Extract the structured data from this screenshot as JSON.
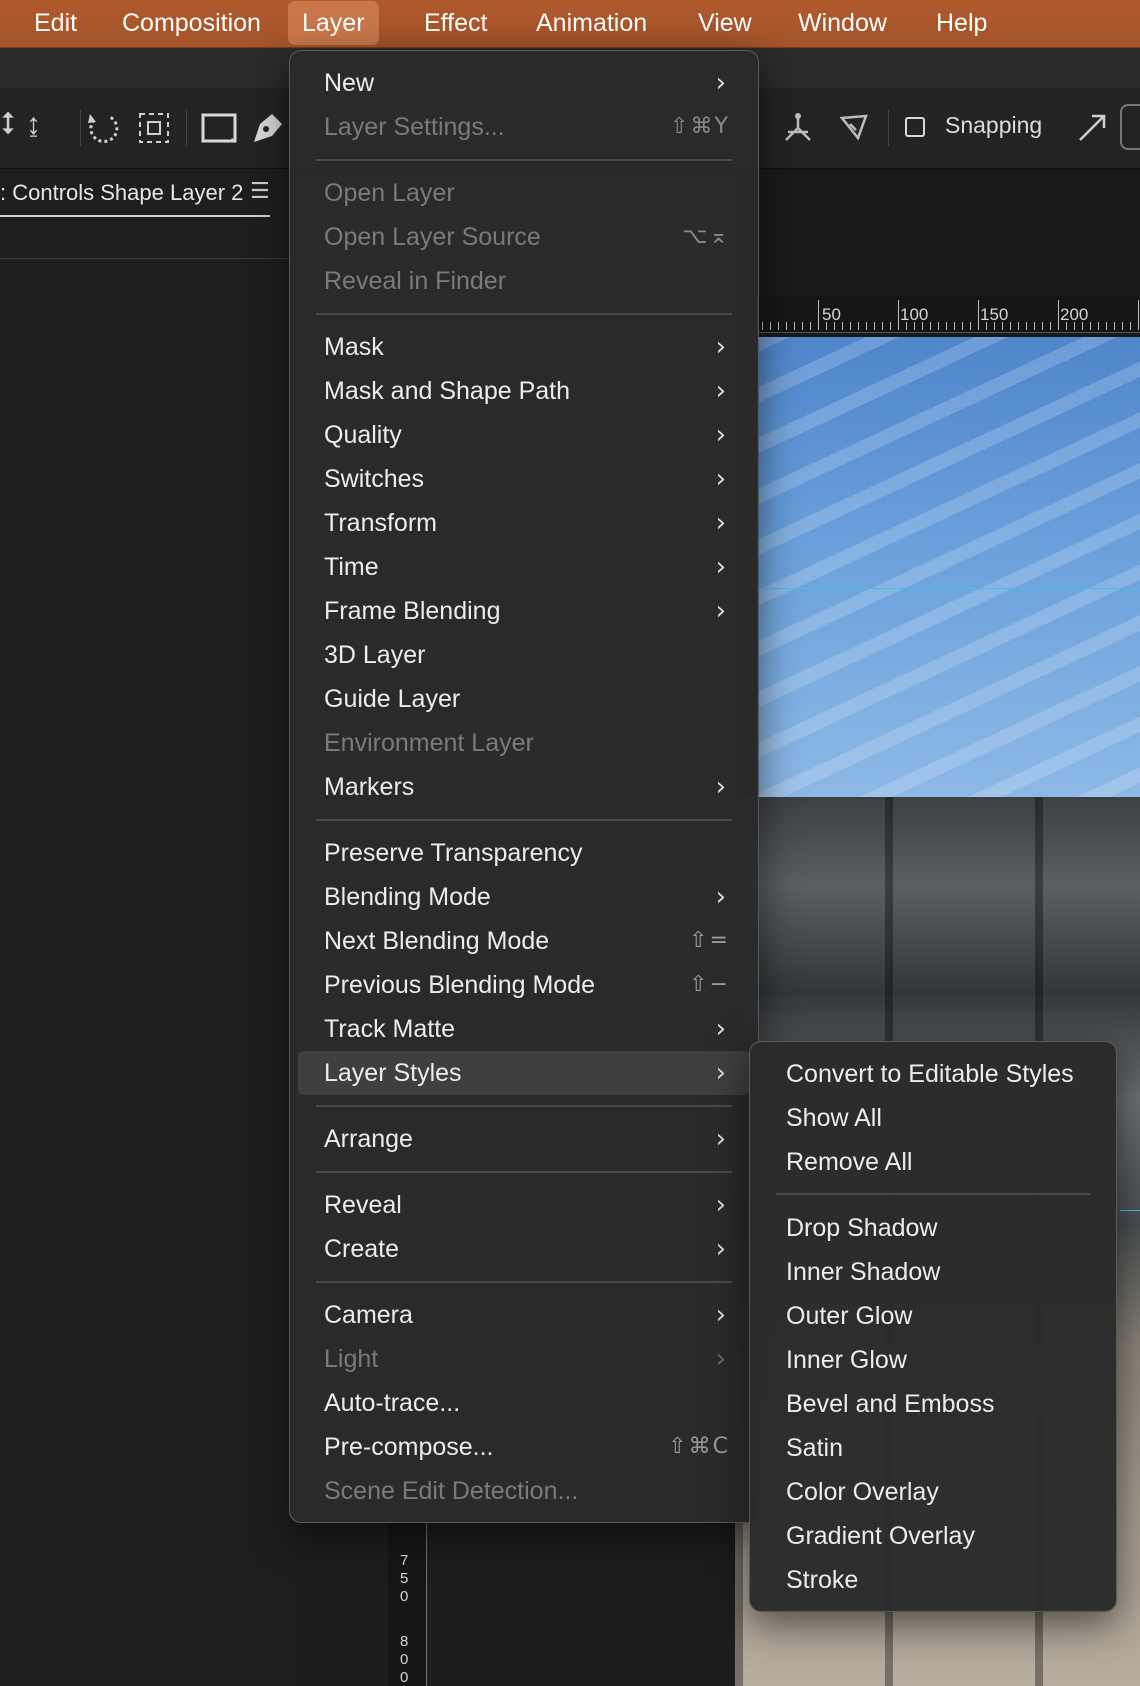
{
  "menubar": {
    "items": [
      "Edit",
      "Composition",
      "Layer",
      "Effect",
      "Animation",
      "View",
      "Window",
      "Help"
    ],
    "active": "Layer"
  },
  "toolbar": {
    "snapping_label": "Snapping",
    "icons": [
      "move-vertical-icon",
      "rotate-icon",
      "selection-frame-icon",
      "rectangle-icon",
      "pen-icon",
      "puppet-icon",
      "puppet-pin-icon",
      "expand-icon"
    ]
  },
  "panel": {
    "tab_label": ": Controls Shape Layer 2",
    "menu_glyph": "☰"
  },
  "ruler": {
    "top_labels": [
      "50",
      "100",
      "150",
      "200"
    ],
    "left_labels": [
      "7",
      "5",
      "0",
      "8",
      "0",
      "0"
    ]
  },
  "layer_menu": {
    "items": [
      {
        "label": "New",
        "enabled": true,
        "submenu": true
      },
      {
        "label": "Layer Settings...",
        "enabled": false,
        "shortcut": "⇧⌘Y"
      },
      {
        "label": "Open Layer",
        "enabled": false
      },
      {
        "label": "Open Layer Source",
        "enabled": false,
        "shortcut": "⌥⌅"
      },
      {
        "label": "Reveal in Finder",
        "enabled": false
      },
      {
        "label": "Mask",
        "enabled": true,
        "submenu": true
      },
      {
        "label": "Mask and Shape Path",
        "enabled": true,
        "submenu": true
      },
      {
        "label": "Quality",
        "enabled": true,
        "submenu": true
      },
      {
        "label": "Switches",
        "enabled": true,
        "submenu": true
      },
      {
        "label": "Transform",
        "enabled": true,
        "submenu": true
      },
      {
        "label": "Time",
        "enabled": true,
        "submenu": true
      },
      {
        "label": "Frame Blending",
        "enabled": true,
        "submenu": true
      },
      {
        "label": "3D Layer",
        "enabled": true
      },
      {
        "label": "Guide Layer",
        "enabled": true
      },
      {
        "label": "Environment Layer",
        "enabled": false
      },
      {
        "label": "Markers",
        "enabled": true,
        "submenu": true
      },
      {
        "label": "Preserve Transparency",
        "enabled": true
      },
      {
        "label": "Blending Mode",
        "enabled": true,
        "submenu": true
      },
      {
        "label": "Next Blending Mode",
        "enabled": true,
        "shortcut": "⇧="
      },
      {
        "label": "Previous Blending Mode",
        "enabled": true,
        "shortcut": "⇧−"
      },
      {
        "label": "Track Matte",
        "enabled": true,
        "submenu": true
      },
      {
        "label": "Layer Styles",
        "enabled": true,
        "submenu": true,
        "highlighted": true
      },
      {
        "label": "Arrange",
        "enabled": true,
        "submenu": true
      },
      {
        "label": "Reveal",
        "enabled": true,
        "submenu": true
      },
      {
        "label": "Create",
        "enabled": true,
        "submenu": true
      },
      {
        "label": "Camera",
        "enabled": true,
        "submenu": true
      },
      {
        "label": "Light",
        "enabled": false,
        "submenu": true
      },
      {
        "label": "Auto-trace...",
        "enabled": true
      },
      {
        "label": "Pre-compose...",
        "enabled": true,
        "shortcut": "⇧⌘C"
      },
      {
        "label": "Scene Edit Detection...",
        "enabled": false
      }
    ]
  },
  "layer_styles_submenu": {
    "items": [
      "Convert to Editable Styles",
      "Show All",
      "Remove All",
      "Drop Shadow",
      "Inner Shadow",
      "Outer Glow",
      "Inner Glow",
      "Bevel and Emboss",
      "Satin",
      "Color Overlay",
      "Gradient Overlay",
      "Stroke"
    ]
  },
  "colors": {
    "menubar_bg": "#a4532a",
    "menu_bg": "#2a2a2a",
    "disabled_text": "#7a7a7a",
    "guide_line": "#3fc4e6"
  }
}
